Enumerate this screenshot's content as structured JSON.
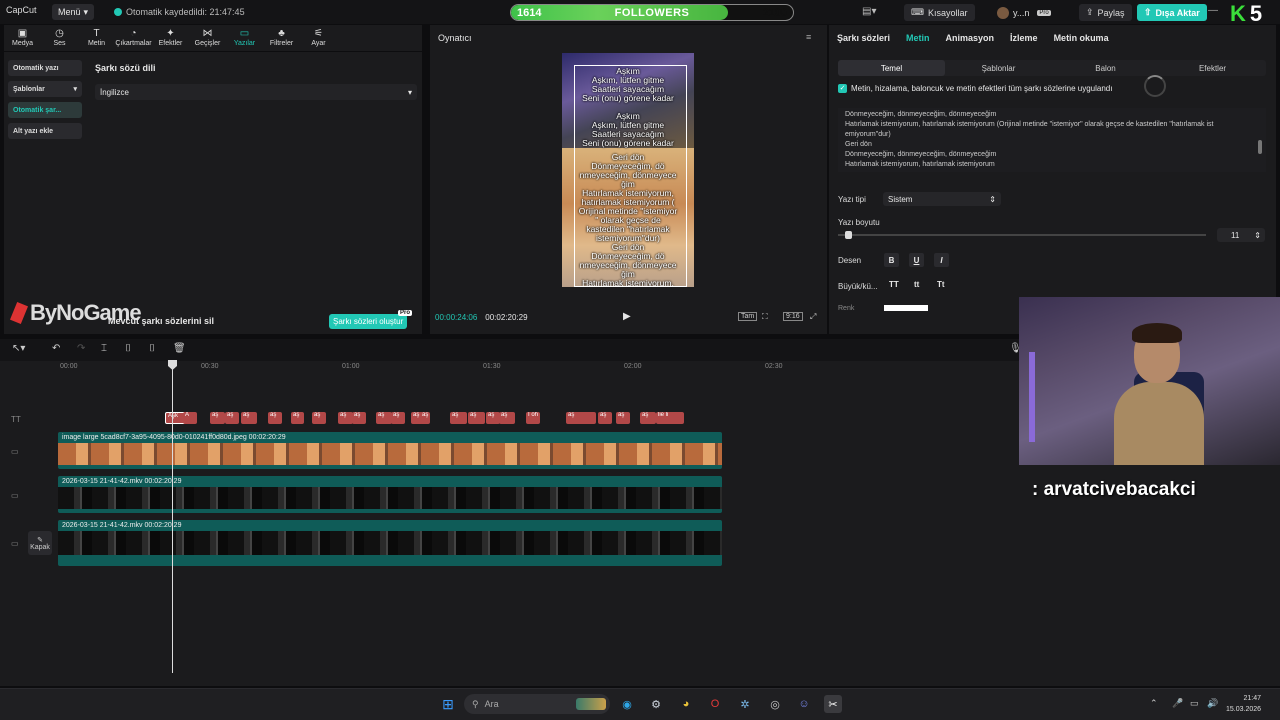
{
  "titlebar": {
    "app_name": "CapCut",
    "menu_label": "Menü",
    "autosave": "Otomatik kaydedildi: 21:47:45",
    "shortcuts": "Kısayollar",
    "user": "y...n",
    "share": "Paylaş",
    "export": "Dışa Aktar",
    "followers": {
      "current": "1614",
      "label": "FOLLOWERS",
      "goal": "2100",
      "progress": 0.768
    }
  },
  "overlay_badge": {
    "k": "K",
    "number": "5"
  },
  "tooltabs": [
    {
      "label": "Medya",
      "icon": "▣"
    },
    {
      "label": "Ses",
      "icon": "◷"
    },
    {
      "label": "Metin",
      "icon": "T"
    },
    {
      "label": "Çıkartmalar",
      "icon": "◔"
    },
    {
      "label": "Efektler",
      "icon": "✦"
    },
    {
      "label": "Geçişler",
      "icon": "⋈"
    },
    {
      "label": "Yazılar",
      "icon": "▭",
      "active": true
    },
    {
      "label": "Filtreler",
      "icon": "♣"
    },
    {
      "label": "Ayar",
      "icon": "⚟"
    }
  ],
  "leftpanel": {
    "side_items": [
      "Otomatik yazı",
      "Şablonlar",
      "Otomatik şar...",
      "Alt yazı ekle"
    ],
    "title": "Şarkı sözü dili",
    "language": "İngilizce",
    "brand": "ByNoGame",
    "delete_label": "Mevcut şarkı sözlerini sil",
    "create_btn": "Şarkı sözleri oluştur",
    "pro": "Pro"
  },
  "player": {
    "title": "Oynatıcı",
    "current_time": "00:00:24:06",
    "total_time": "00:02:20:29",
    "full_label": "Tam",
    "ratio": "9:16",
    "canvas_lines_top": [
      "Aşkım",
      "Aşkım, lütfen gitme",
      "Saatleri sayacağım",
      "Seni (onu) görene kadar",
      "",
      "Aşkım",
      "Aşkım, lütfen gitme",
      "Saatleri sayacağım",
      "Seni (onu) görene kadar"
    ],
    "canvas_lines_bottom": [
      "Geri dön",
      "Dönmeyeceğim, dö",
      "nmeyeceğim, dönmeyece",
      "ğim",
      "Hatırlamak istemiyorum,",
      "hatırlamak istemiyorum (",
      "Orijinal metinde \"istemiyor",
      "\" olarak geçse de",
      "kastedilen \"hatırlamak",
      "istemiyorum\"dur)",
      "Geri dön",
      "Dönmeyeceğim, dö",
      "nmeyeceğim, dönmeyece",
      "ğim",
      "Hatırlamak istemiyorum,",
      "hatırlamak istemiyorum"
    ]
  },
  "rightpanel": {
    "tabs": [
      "Şarkı sözleri",
      "Metin",
      "Animasyon",
      "İzleme",
      "Metin okuma"
    ],
    "active_tab": "Metin",
    "subtabs": [
      "Temel",
      "Şablonlar",
      "Balon",
      "Efektler"
    ],
    "apply_all": "Metin, hizalama, baloncuk ve metin efektleri tüm şarkı sözlerine uygulandı",
    "text_lines": [
      "Dönmeyeceğim, dönmeyeceğim, dönmeyeceğim",
      "Hatırlamak istemiyorum, hatırlamak istemiyorum (Orijinal metinde \"istemiyor\" olarak geçse de kastedilen \"hatırlamak ist",
      "emiyorum\"dur)",
      "Geri dön",
      "Dönmeyeceğim, dönmeyeceğim, dönmeyeceğim",
      "Hatırlamak istemiyorum, hatırlamak istemiyorum"
    ],
    "font_label": "Yazı tipi",
    "font_value": "Sistem",
    "size_label": "Yazı boyutu",
    "size_value": "11",
    "style_label": "Desen",
    "case_label": "Büyük/kü...",
    "case_options": [
      "TT",
      "tt",
      "Tt"
    ],
    "color_label": "Renk"
  },
  "timeline": {
    "ruler": [
      "00:00",
      "00:30",
      "01:00",
      "01:30",
      "02:00",
      "02:30"
    ],
    "text_clips": [
      "Aşk",
      "A",
      "aş",
      "aş",
      "aş",
      "aş",
      "aş",
      "aş",
      "aş",
      "aş",
      "aş",
      "aş",
      "aş",
      "aş",
      "aş",
      "aş",
      "aş",
      "aş",
      "I oh I",
      "aş",
      "aş",
      "aş",
      "aş",
      "lie li"
    ],
    "image_clip": "image large 5cad8cf7-3a95-4095-80d0-010241ff0d80d.jpeg  00:02:20:29",
    "video_clip_1": "2026-03-15 21-41-42.mkv   00:02:20:29",
    "video_clip_2": "2026-03-15 21-41-42.mkv   00:02:20:29",
    "cover_label": "Kapak"
  },
  "stream": {
    "chat_name": ": arvatcivebacakci"
  },
  "taskbar": {
    "search": "Ara",
    "time": "21:47",
    "date": "15.03.2026"
  }
}
